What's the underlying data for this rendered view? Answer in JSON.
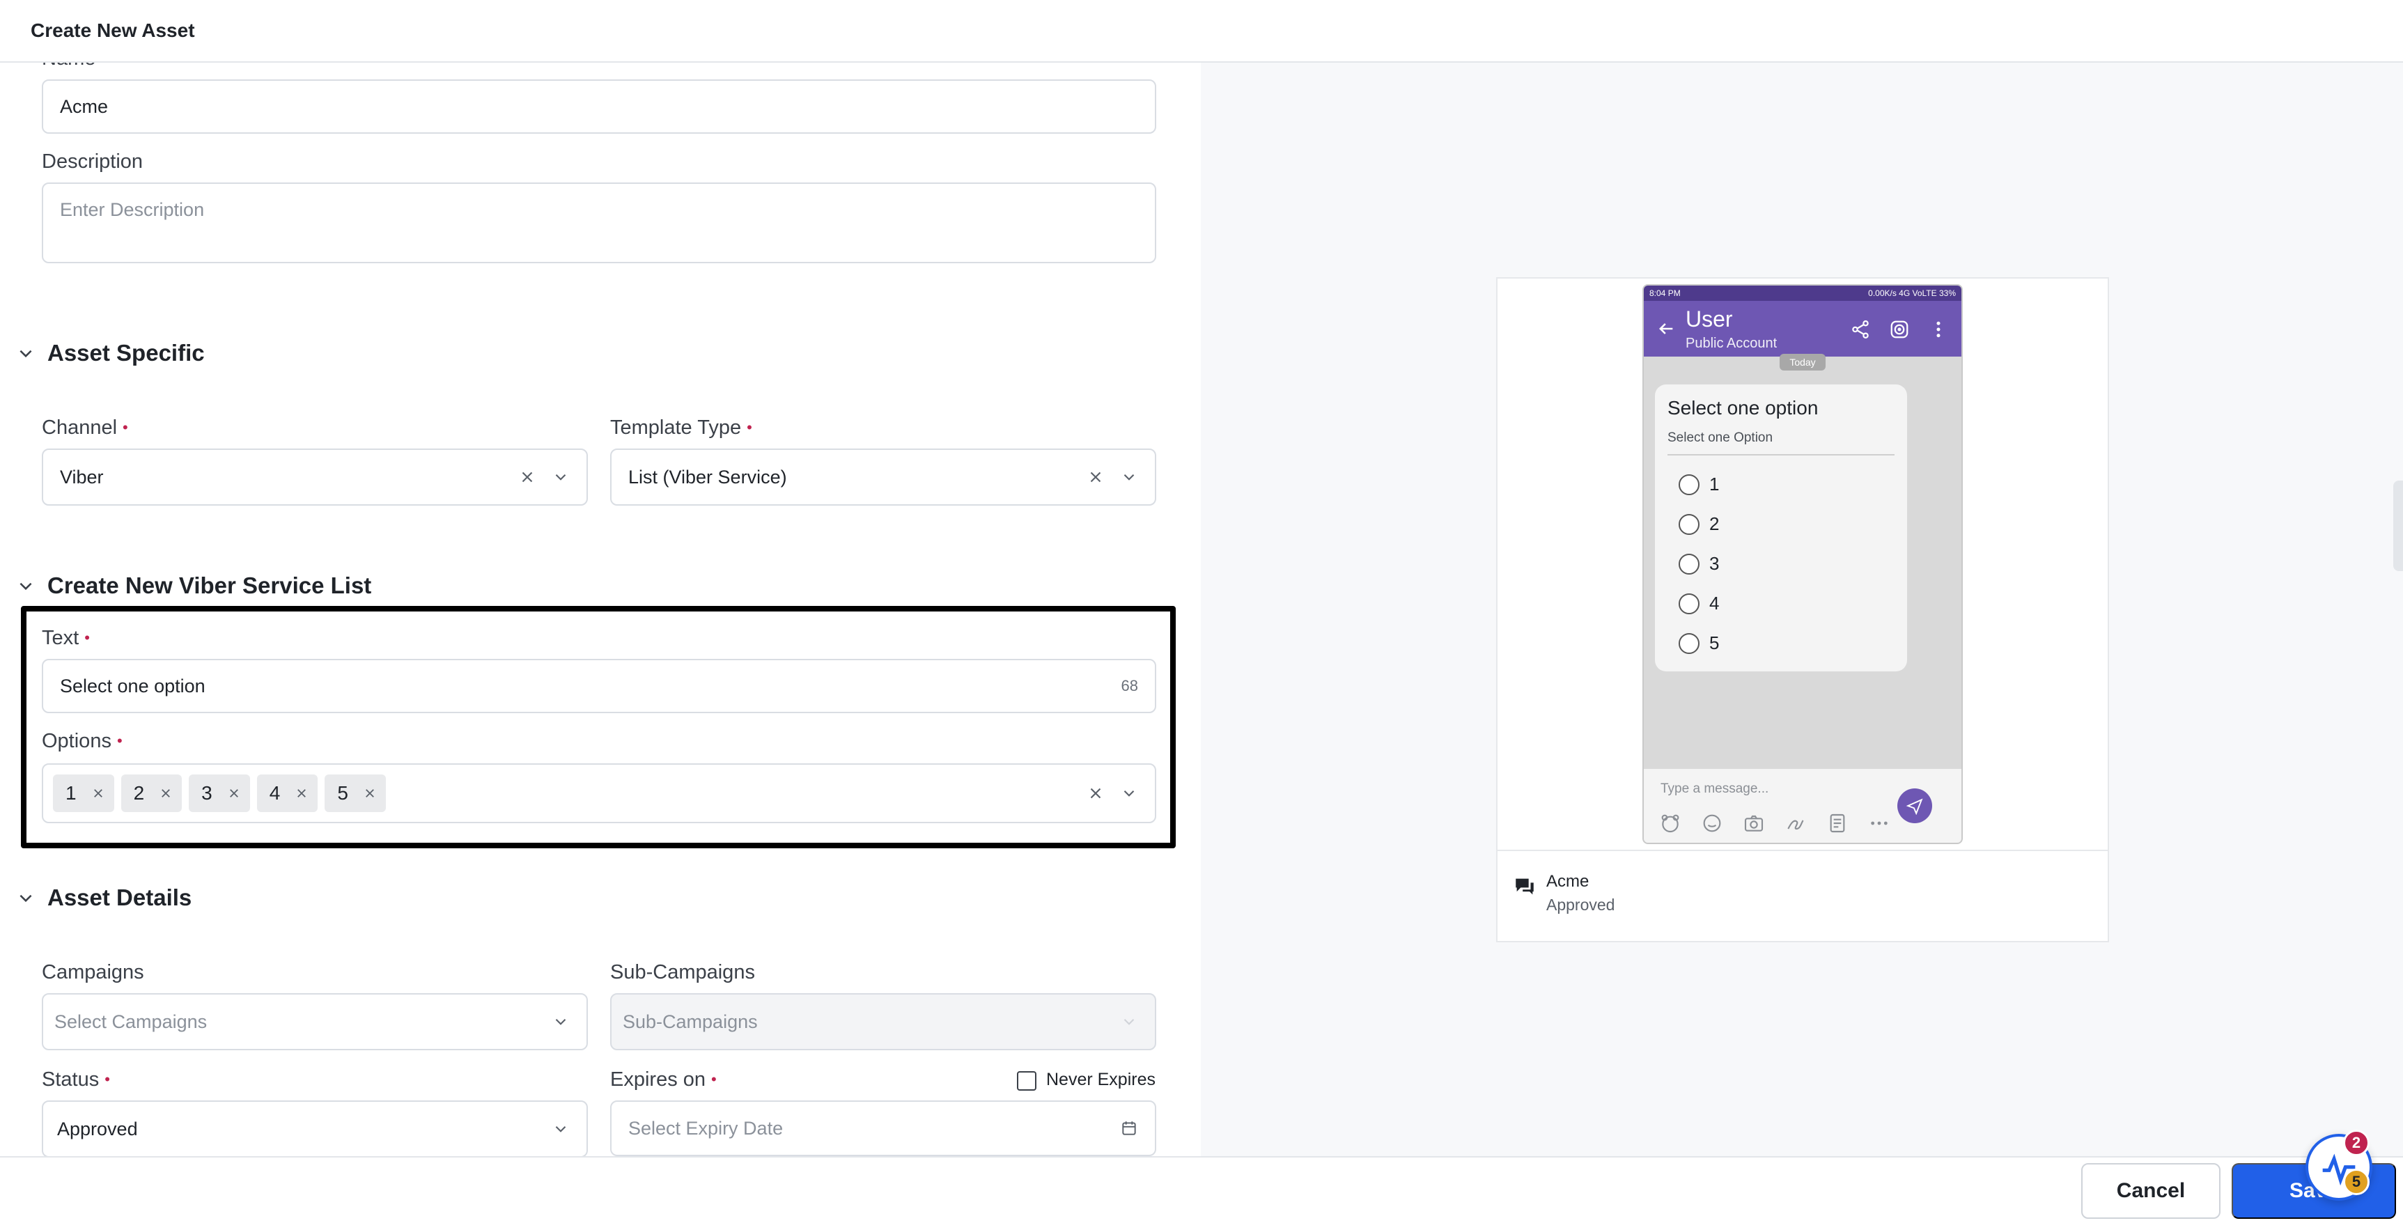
{
  "header": {
    "title": "Create New Asset"
  },
  "form": {
    "name": {
      "label": "Name",
      "value": "Acme"
    },
    "description": {
      "label": "Description",
      "placeholder": "Enter Description"
    },
    "sections": {
      "asset_specific": "Asset Specific",
      "create_list": "Create New Viber Service List",
      "asset_details": "Asset Details"
    },
    "channel": {
      "label": "Channel",
      "value": "Viber"
    },
    "template_type": {
      "label": "Template Type",
      "value": "List (Viber Service)"
    },
    "text": {
      "label": "Text",
      "value": "Select one option",
      "counter": "68"
    },
    "options": {
      "label": "Options",
      "values": [
        "1",
        "2",
        "3",
        "4",
        "5"
      ]
    },
    "campaigns": {
      "label": "Campaigns",
      "placeholder": "Select Campaigns"
    },
    "sub_campaigns": {
      "label": "Sub-Campaigns",
      "placeholder": "Sub-Campaigns"
    },
    "status": {
      "label": "Status",
      "value": "Approved"
    },
    "expires_on": {
      "label": "Expires on",
      "placeholder": "Select Expiry Date",
      "never_expires_label": "Never Expires"
    }
  },
  "preview": {
    "status_time": "8:04 PM",
    "status_right": "0.00K/s  4G VoLTE  33%",
    "contact_name": "User",
    "contact_sub": "Public Account",
    "today": "Today",
    "bubble_title": "Select one option",
    "bubble_sub": "Select one Option",
    "options": [
      "1",
      "2",
      "3",
      "4",
      "5"
    ],
    "composer_placeholder": "Type a message...",
    "asset_name": "Acme",
    "asset_status": "Approved"
  },
  "footer": {
    "cancel_label": "Cancel",
    "save_label": "Save"
  },
  "widget": {
    "badge_count_top": "2",
    "badge_count_bottom": "5"
  },
  "colors": {
    "accent": "#2160e8",
    "required": "#c0234f",
    "viber_purple": "#6e57b3"
  }
}
